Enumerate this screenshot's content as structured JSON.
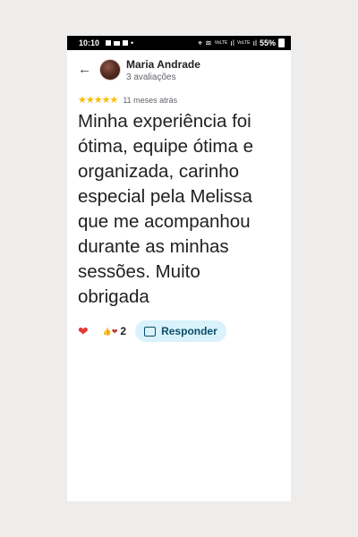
{
  "status_bar": {
    "time": "10:10",
    "battery": "55%",
    "net_label_1": "VoLTE",
    "net_label_2": "VoLTE"
  },
  "header": {
    "reviewer_name": "Maria Andrade",
    "review_count": "3 avaliações"
  },
  "review": {
    "rating": 5,
    "stars": "★★★★★",
    "time_ago": "11 meses atrás",
    "text": "Minha experiência foi\nótima, equipe ótima e\norganizada, carinho\nespecial pela Melissa\nque me acompanhou\ndurante as minhas\nsessões. Muito\nobrigada"
  },
  "actions": {
    "reaction_count": "2",
    "reply_label": "Responder"
  },
  "colors": {
    "star": "#fbbc04",
    "heart": "#e53935",
    "reply_bg": "#d9f2fb",
    "reply_text": "#0b4f6c"
  }
}
